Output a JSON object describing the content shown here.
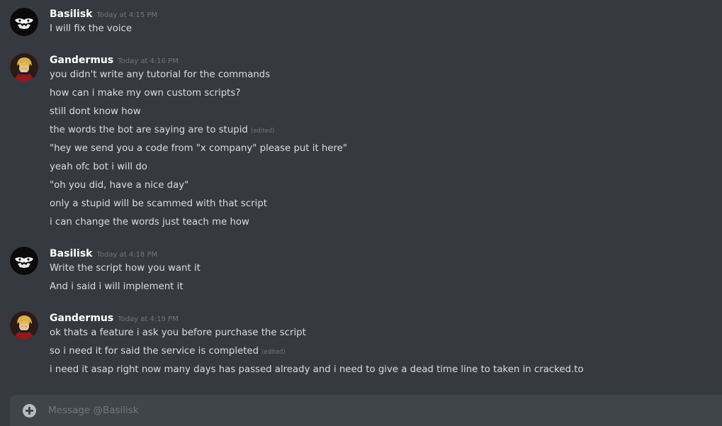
{
  "messages": [
    {
      "author": "Basilisk",
      "timestamp": "Today at 4:15 PM",
      "avatar": "basilisk-avatar",
      "lines": [
        {
          "text": "I will fix the voice"
        }
      ]
    },
    {
      "author": "Gandermus",
      "timestamp": "Today at 4:16 PM",
      "avatar": "gandermus-avatar",
      "lines": [
        {
          "text": "you didn't write any tutorial for the commands"
        },
        {
          "text": "how can i make my own custom scripts?"
        },
        {
          "text": "still dont know how"
        },
        {
          "text": "the words the bot are saying are to stupid",
          "edited": "(edited)"
        },
        {
          "text": "\"hey we send you a code from \"x company\" please put it here\""
        },
        {
          "text": "yeah ofc bot i will do"
        },
        {
          "text": "\"oh you did, have a nice day\""
        },
        {
          "text": "only a stupid will be scammed with that script"
        },
        {
          "text": "i can change the words just teach me how"
        }
      ]
    },
    {
      "author": "Basilisk",
      "timestamp": "Today at 4:18 PM",
      "avatar": "basilisk-avatar",
      "lines": [
        {
          "text": "Write the script how you want it"
        },
        {
          "text": "And i said i will implement it"
        }
      ]
    },
    {
      "author": "Gandermus",
      "timestamp": "Today at 4:19 PM",
      "avatar": "gandermus-avatar",
      "lines": [
        {
          "text": "ok thats a feature i ask you before purchase the script"
        },
        {
          "text": "so i need it for said the service is completed",
          "edited": "(edited)"
        },
        {
          "text": "i need it asap right now many days has passed already and i need to give a dead time line to taken in cracked.to"
        }
      ]
    }
  ],
  "composer": {
    "placeholder": "Message @Basilisk",
    "value": "",
    "attach_icon": "plus-circle-icon"
  },
  "colors": {
    "background": "#36393f",
    "composer": "#40444b",
    "text": "#dcddde",
    "muted": "#72767d",
    "username": "#ffffff"
  }
}
